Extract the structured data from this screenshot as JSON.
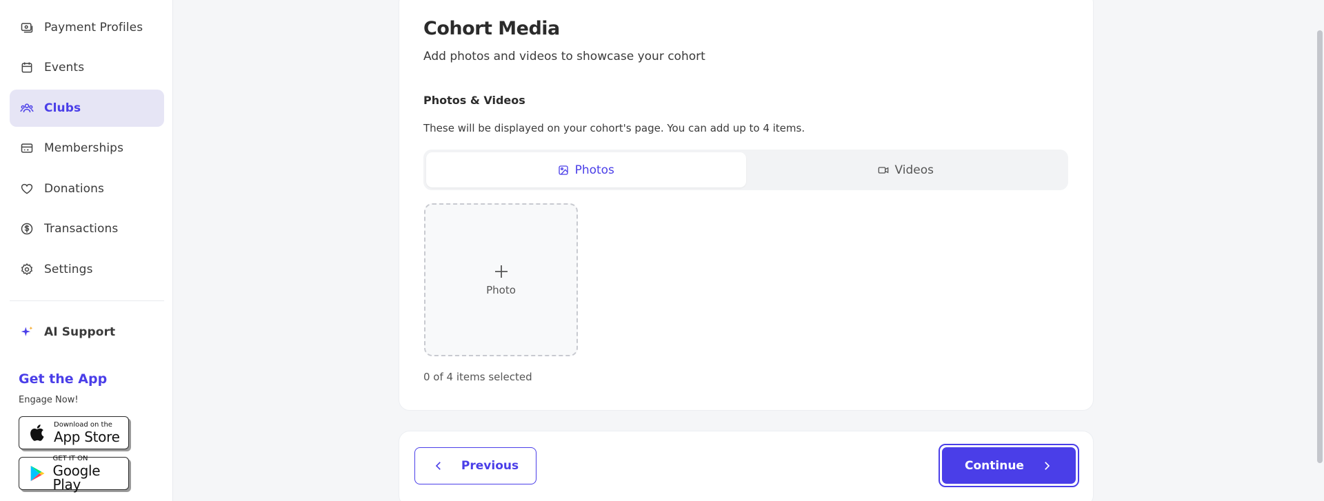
{
  "sidebar": {
    "items": [
      {
        "label": "Payment Profiles",
        "icon": "payment-profile-icon"
      },
      {
        "label": "Events",
        "icon": "calendar-icon"
      },
      {
        "label": "Clubs",
        "icon": "users-icon",
        "active": true
      },
      {
        "label": "Memberships",
        "icon": "card-icon"
      },
      {
        "label": "Donations",
        "icon": "heart-icon"
      },
      {
        "label": "Transactions",
        "icon": "dollar-circle-icon"
      },
      {
        "label": "Settings",
        "icon": "gear-icon"
      }
    ],
    "ai_support": "AI Support",
    "get_app": "Get the App",
    "engage": "Engage Now!",
    "app_store": {
      "small": "Download on the",
      "big": "App Store"
    },
    "google_play": {
      "small": "GET IT ON",
      "big": "Google Play"
    }
  },
  "main": {
    "title": "Cohort Media",
    "subtitle": "Add photos and videos to showcase your cohort",
    "section_title": "Photos & Videos",
    "section_desc": "These will be displayed on your cohort's page. You can add up to 4 items.",
    "tabs": [
      {
        "label": "Photos",
        "icon": "image-icon",
        "active": true
      },
      {
        "label": "Videos",
        "icon": "video-icon",
        "active": false
      }
    ],
    "dropzone_label": "Photo",
    "counter": "0 of 4 items selected"
  },
  "footer": {
    "previous": "Previous",
    "continue": "Continue"
  },
  "colors": {
    "accent": "#4a3ee8",
    "active_bg": "#e6e5f5",
    "page_bg": "#f5f6f8"
  }
}
